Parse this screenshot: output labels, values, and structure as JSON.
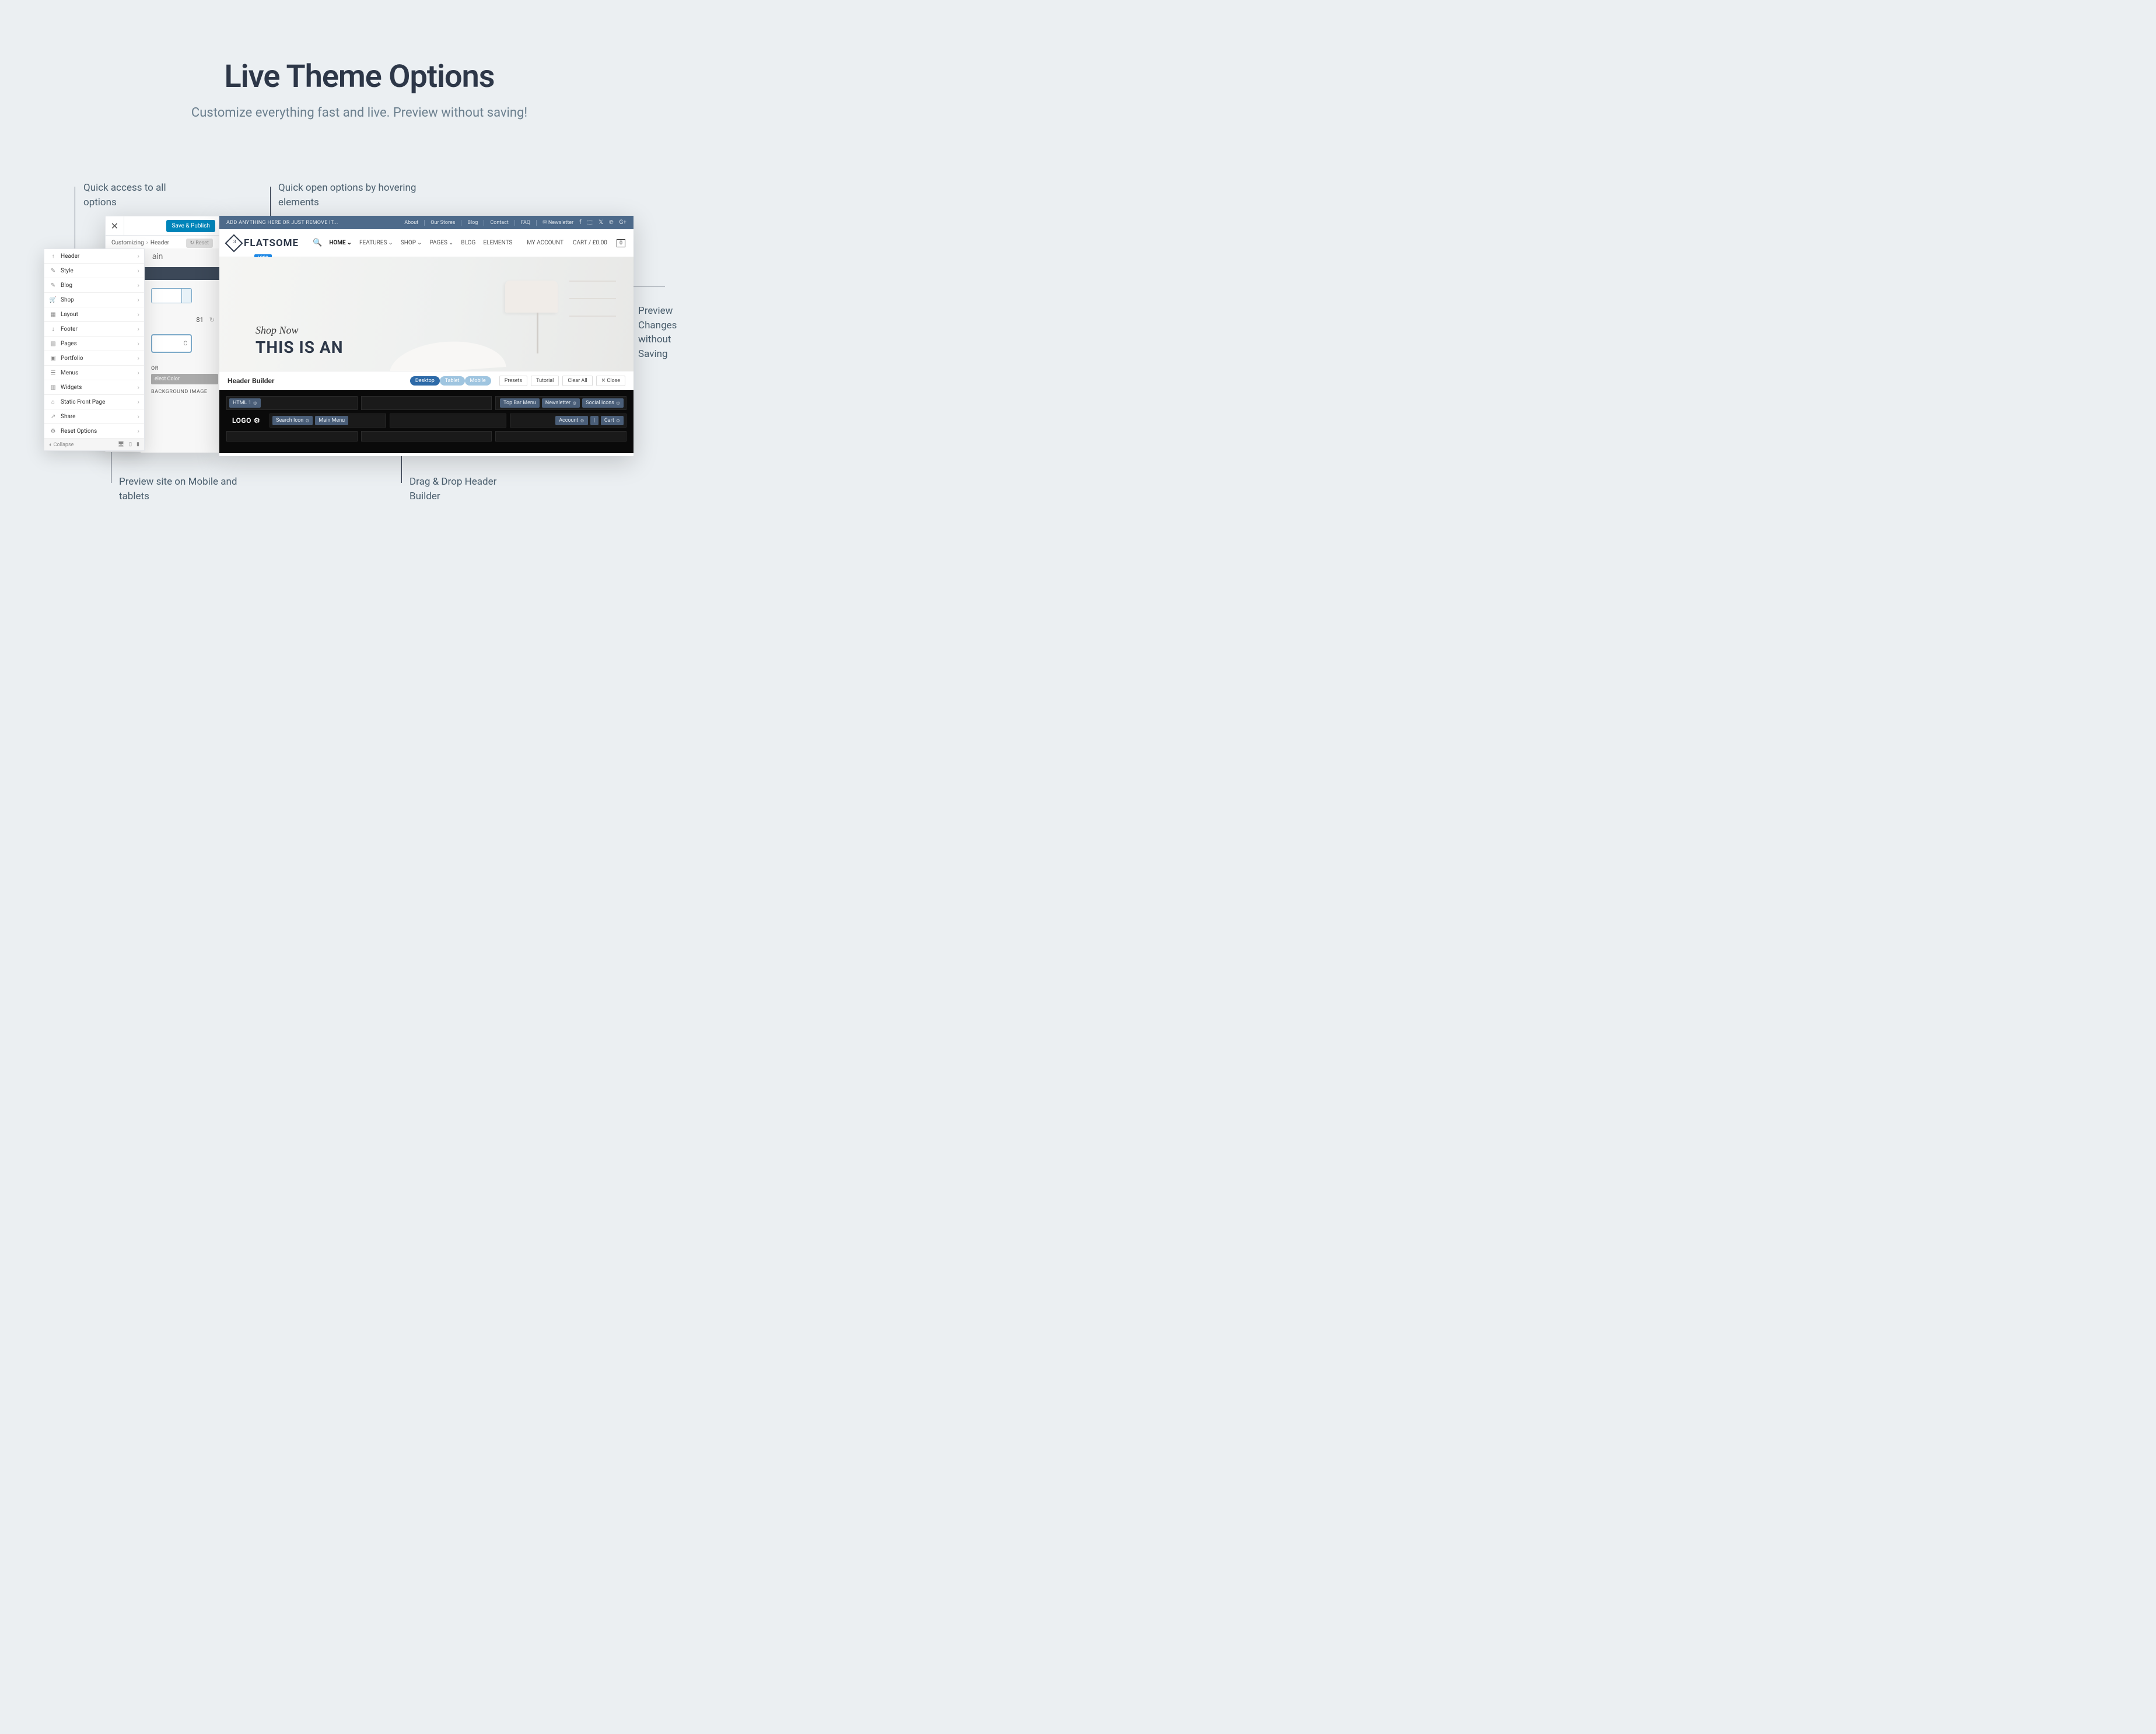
{
  "hero": {
    "title": "Live Theme Options",
    "subtitle": "Customize everything fast and live. Preview without saving!"
  },
  "callouts": {
    "quick_access": "Quick access to all options",
    "quick_open": "Quick open options by hovering elements",
    "preview_changes": "Preview Changes without Saving",
    "preview_mobile": "Preview site on Mobile and tablets",
    "drag_drop": "Drag & Drop Header Builder"
  },
  "customizer": {
    "save": "Save & Publish",
    "crumb_a": "Customizing",
    "crumb_b": "Header",
    "reset": "↻ Reset",
    "main_title": "ain",
    "val_81": "81",
    "select_hint": "C",
    "label_or": "OR",
    "select_color": "elect Color",
    "bg_image": "BACKGROUND IMAGE"
  },
  "sidebar": {
    "items": [
      {
        "icon": "↑",
        "label": "Header"
      },
      {
        "icon": "✎",
        "label": "Style"
      },
      {
        "icon": "✎",
        "label": "Blog"
      },
      {
        "icon": "🛒",
        "label": "Shop"
      },
      {
        "icon": "▦",
        "label": "Layout"
      },
      {
        "icon": "↓",
        "label": "Footer"
      },
      {
        "icon": "▤",
        "label": "Pages"
      },
      {
        "icon": "▣",
        "label": "Portfolio"
      },
      {
        "icon": "☰",
        "label": "Menus"
      },
      {
        "icon": "▥",
        "label": "Widgets"
      },
      {
        "icon": "⌂",
        "label": "Static Front Page"
      },
      {
        "icon": "↗",
        "label": "Share"
      },
      {
        "icon": "⚙",
        "label": "Reset Options"
      }
    ],
    "collapse": "Collapse"
  },
  "topbar": {
    "left": "ADD ANYTHING HERE OR JUST REMOVE IT...",
    "links": [
      "About",
      "Our Stores",
      "Blog",
      "Contact",
      "FAQ"
    ],
    "newsletter": "✉ Newsletter"
  },
  "nav": {
    "brand": "FLATSOME",
    "logo_tag": "LOGO",
    "items": [
      "HOME",
      "FEATURES",
      "SHOP",
      "PAGES",
      "BLOG",
      "ELEMENTS"
    ],
    "account": "MY ACCOUNT",
    "cart": "CART / £0.00",
    "cart_count": "0"
  },
  "hero_img": {
    "shop_now": "Shop Now",
    "headline": "THIS IS AN"
  },
  "header_builder": {
    "title": "Header Builder",
    "devices": [
      "Desktop",
      "Tablet",
      "Mobile"
    ],
    "buttons": [
      "Presets",
      "Tutorial",
      "Clear All",
      "✕ Close"
    ],
    "row1_left": "HTML 1",
    "row1_right": [
      "Top Bar Menu",
      "Newsletter",
      "Social Icons"
    ],
    "row2_logo": "LOGO",
    "row2_left": [
      "Search Icon",
      "Main Menu"
    ],
    "row2_right": [
      "Account",
      "|",
      "Cart"
    ]
  }
}
